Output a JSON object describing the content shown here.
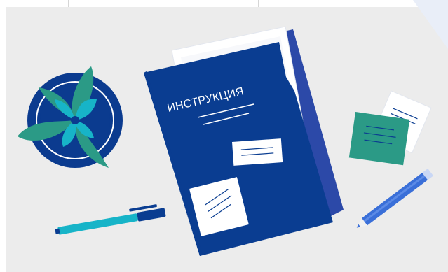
{
  "folder": {
    "title": "ИНСТРУКЦИЯ"
  },
  "colors": {
    "background": "#ececec",
    "folder_blue": "#0a3d91",
    "folder_back": "#2c49a8",
    "teal": "#2b9a86",
    "cyan": "#17b4c8",
    "pencil_blue": "#3a6fd8",
    "paper": "#ffffff"
  },
  "icons": [
    "potted-plant-icon",
    "folder-icon",
    "pen-icon",
    "pencil-icon",
    "sticky-notes-icon"
  ]
}
